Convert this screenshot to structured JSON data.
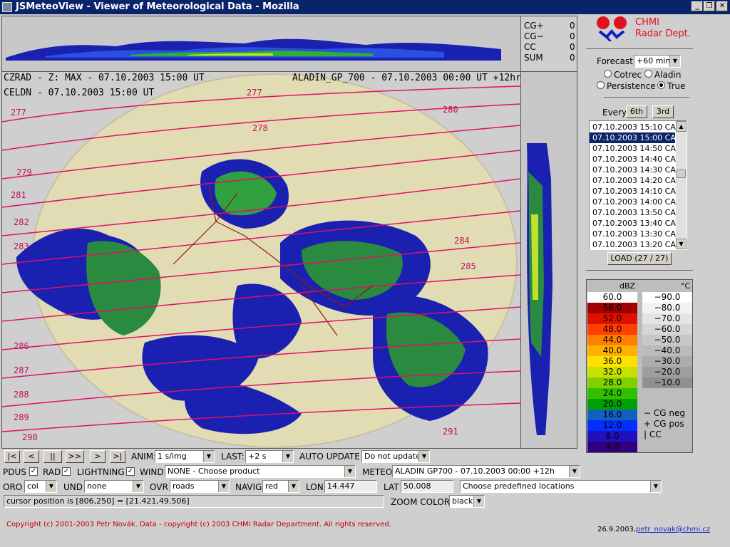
{
  "window": {
    "title": "JSMeteoView - Viewer of Meteorological Data - Mozilla",
    "minimize": "_",
    "maximize": "❐",
    "close": "✕"
  },
  "lightning": {
    "rows": [
      {
        "label": "CG+",
        "value": "0"
      },
      {
        "label": "CG−",
        "value": "0"
      },
      {
        "label": "CC",
        "value": "0"
      },
      {
        "label": "SUM",
        "value": "0"
      }
    ]
  },
  "map": {
    "header_left_1": "CZRAD - Z: MAX - 07.10.2003 15:00 UT",
    "header_left_2": "CELDN - 07.10.2003 15:00 UT",
    "header_right": "ALADIN_GP_700 - 07.10.2003 00:00 UT +12hr",
    "isolines": [
      "277",
      "277",
      "278",
      "279",
      "280",
      "281",
      "282",
      "283",
      "284",
      "285",
      "286",
      "287",
      "288",
      "289",
      "290",
      "280",
      "281",
      "282",
      "283",
      "284",
      "285",
      "286",
      "287",
      "288",
      "291"
    ]
  },
  "logo": {
    "line1": "CHMI",
    "line2": "Radar Dept."
  },
  "forecast": {
    "label": "Forecast",
    "value": "+60 min",
    "opt_cotrec": "Cotrec",
    "opt_aladin": "Aladin",
    "opt_persistence": "Persistence",
    "opt_true": "True"
  },
  "every": {
    "label": "Every",
    "btn6": "6th",
    "btn3": "3rd"
  },
  "timelist": {
    "items": [
      "07.10.2003 15:10 CA",
      "07.10.2003 15:00 CA",
      "07.10.2003 14:50 CA",
      "07.10.2003 14:40 CA",
      "07.10.2003 14:30 CA",
      "07.10.2003 14:20 CA",
      "07.10.2003 14:10 CA",
      "07.10.2003 14:00 CA",
      "07.10.2003 13:50 CA",
      "07.10.2003 13:40 CA",
      "07.10.2003 13:30 CA",
      "07.10.2003 13:20 CA"
    ],
    "selected_index": 1
  },
  "load_button": "LOAD (27 / 27)",
  "legend": {
    "dbz_unit": "dBZ",
    "temp_unit": "°C",
    "dbz": [
      {
        "v": "60.0",
        "c": "#ffffff",
        "t": "#000"
      },
      {
        "v": "56.0",
        "c": "#a00000",
        "t": "#000"
      },
      {
        "v": "52.0",
        "c": "#e01000",
        "t": "#000"
      },
      {
        "v": "48.0",
        "c": "#ff4000",
        "t": "#000"
      },
      {
        "v": "44.0",
        "c": "#ff8000",
        "t": "#000"
      },
      {
        "v": "40.0",
        "c": "#ffb000",
        "t": "#000"
      },
      {
        "v": "36.0",
        "c": "#ffe000",
        "t": "#000"
      },
      {
        "v": "32.0",
        "c": "#c8e000",
        "t": "#000"
      },
      {
        "v": "28.0",
        "c": "#80d000",
        "t": "#000"
      },
      {
        "v": "24.0",
        "c": "#30c000",
        "t": "#000"
      },
      {
        "v": "20.0",
        "c": "#00a000",
        "t": "#000"
      },
      {
        "v": "16.0",
        "c": "#1060c0",
        "t": "#000"
      },
      {
        "v": "12.0",
        "c": "#0030ff",
        "t": "#000"
      },
      {
        "v": "8.0",
        "c": "#2010c0",
        "t": "#000"
      },
      {
        "v": "4.0",
        "c": "#300080",
        "t": "#000"
      }
    ],
    "temp": [
      {
        "v": "−90.0",
        "c": "#ffffff"
      },
      {
        "v": "−80.0",
        "c": "#f2f2f2"
      },
      {
        "v": "−70.0",
        "c": "#e4e4e4"
      },
      {
        "v": "−60.0",
        "c": "#d6d6d6"
      },
      {
        "v": "−50.0",
        "c": "#c8c8c8"
      },
      {
        "v": "−40.0",
        "c": "#bababa"
      },
      {
        "v": "−30.0",
        "c": "#acacac"
      },
      {
        "v": "−20.0",
        "c": "#9e9e9e"
      },
      {
        "v": "−10.0",
        "c": "#909090"
      }
    ],
    "cg_neg": "−  CG  neg",
    "cg_pos": "+  CG  pos",
    "cc": "|    CC"
  },
  "controls": {
    "nav": [
      "|<",
      "<",
      "||",
      ">>",
      ">",
      ">|"
    ],
    "anim_label": "ANIM:",
    "anim_value": "1 s/img",
    "last_label": "LAST:",
    "last_value": "+2 s",
    "auto_label": "AUTO UPDATE",
    "auto_value": "Do not update",
    "pdus_label": "PDUS",
    "rad_label": "RAD",
    "lightning_label": "LIGHTNING",
    "wind_label": "WIND",
    "wind_value": "NONE - Choose product",
    "meteo_label": "METEO",
    "meteo_value": "ALADIN GP700 - 07.10.2003 00:00 +12h",
    "oro_label": "ORO",
    "oro_value": "col",
    "und_label": "UND",
    "und_value": "none",
    "ovr_label": "OVR",
    "ovr_value": "roads",
    "navig_label": "NAVIG",
    "navig_value": "red",
    "lon_label": "LON",
    "lon_value": "14.447",
    "lat_label": "LAT",
    "lat_value": "50.008",
    "locations_value": "Choose predefined locations",
    "cursor_text": "cursor position is [806,250] = [21.421,49.506]",
    "zoom_label": "ZOOM COLOR",
    "zoom_value": "black"
  },
  "footer": {
    "copyright": "Copyright (c) 2001-2003 Petr Novák. Data - copyright (c) 2003 CHMI Radar Department. All rights reserved.",
    "date": "26.9.2003,",
    "email": "petr_novak@chmi.cz"
  }
}
